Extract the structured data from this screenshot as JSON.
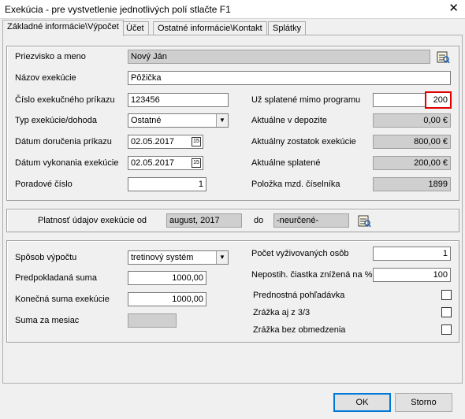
{
  "window": {
    "title": "Exekúcia - pre vystvetlenie jednotlivých polí stlačte F1",
    "close_glyph": "✕"
  },
  "tabs": [
    {
      "label": "Základné informácie\\Výpočet"
    },
    {
      "label": "Účet"
    },
    {
      "label": "Ostatné informácie\\Kontakt"
    },
    {
      "label": "Splátky"
    }
  ],
  "basic": {
    "name_label": "Priezvisko a meno",
    "name_value": "Nový Ján",
    "exec_name_label": "Názov exekúcie",
    "exec_name_value": "Pôžička",
    "order_no_label": "Číslo exekučného príkazu",
    "order_no_value": "123456",
    "type_label": "Typ exekúcie/dohoda",
    "type_value": "Ostatné",
    "delivery_date_label": "Dátum doručenia príkazu",
    "delivery_date_value": "02.05.2017",
    "exec_date_label": "Dátum vykonania exekúcie",
    "exec_date_value": "02.05.2017",
    "order_label": "Poradové číslo",
    "order_value": "1",
    "paid_outside_label": "Už splatené mimo programu",
    "paid_outside_value": "200",
    "deposit_label": "Aktuálne v depozite",
    "deposit_value": "0,00 €",
    "balance_label": "Aktuálny zostatok exekúcie",
    "balance_value": "800,00 €",
    "paid_label": "Aktuálne splatené",
    "paid_value": "200,00 €",
    "payroll_item_label": "Položka mzd. číselníka",
    "payroll_item_value": "1899"
  },
  "validity": {
    "from_label": "Platnosť údajov exekúcie od",
    "from_value": "august, 2017",
    "to_label": "do",
    "to_value": "-neurčené-"
  },
  "calc": {
    "method_label": "Spôsob výpočtu",
    "method_value": "tretinový systém",
    "expected_label": "Predpokladaná suma",
    "expected_value": "1000,00",
    "final_label": "Konečná suma exekúcie",
    "final_value": "1000,00",
    "monthly_label": "Suma za mesiac",
    "monthly_value": "",
    "dependents_label": "Počet vyživovaných osôb",
    "dependents_value": "1",
    "nonattach_label": "Nepostih. čiastka znížená na %",
    "nonattach_value": "100",
    "priority_label": "Prednostná pohľadávka",
    "third_label": "Zrážka aj z 3/3",
    "unlimited_label": "Zrážka bez obmedzenia"
  },
  "buttons": {
    "ok_label": "OK",
    "cancel_label": "Storno"
  }
}
